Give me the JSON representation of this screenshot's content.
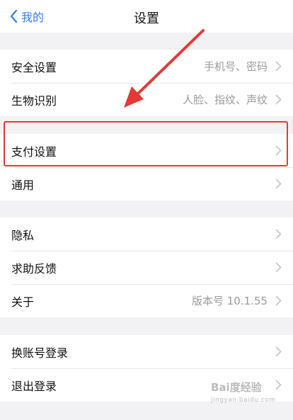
{
  "nav": {
    "back_label": "我的",
    "title": "设置"
  },
  "groups": [
    {
      "items": [
        {
          "label": "安全设置",
          "value": "手机号、密码"
        },
        {
          "label": "生物识别",
          "value": "人脸、指纹、声纹"
        }
      ]
    },
    {
      "items": [
        {
          "label": "支付设置",
          "value": ""
        },
        {
          "label": "通用",
          "value": ""
        }
      ]
    },
    {
      "items": [
        {
          "label": "隐私",
          "value": ""
        },
        {
          "label": "求助反馈",
          "value": ""
        },
        {
          "label": "关于",
          "value": "版本号 10.1.55"
        }
      ]
    },
    {
      "items": [
        {
          "label": "换账号登录",
          "value": ""
        },
        {
          "label": "退出登录",
          "value": ""
        }
      ]
    }
  ],
  "annotation": {
    "highlight_color": "#e53935",
    "arrow_color": "#e53935"
  },
  "watermark": {
    "text": "Bai度经验",
    "sub": "jingyan.baidu.com"
  },
  "colors": {
    "accent": "#2f7df6",
    "background": "#f2f2f4"
  }
}
